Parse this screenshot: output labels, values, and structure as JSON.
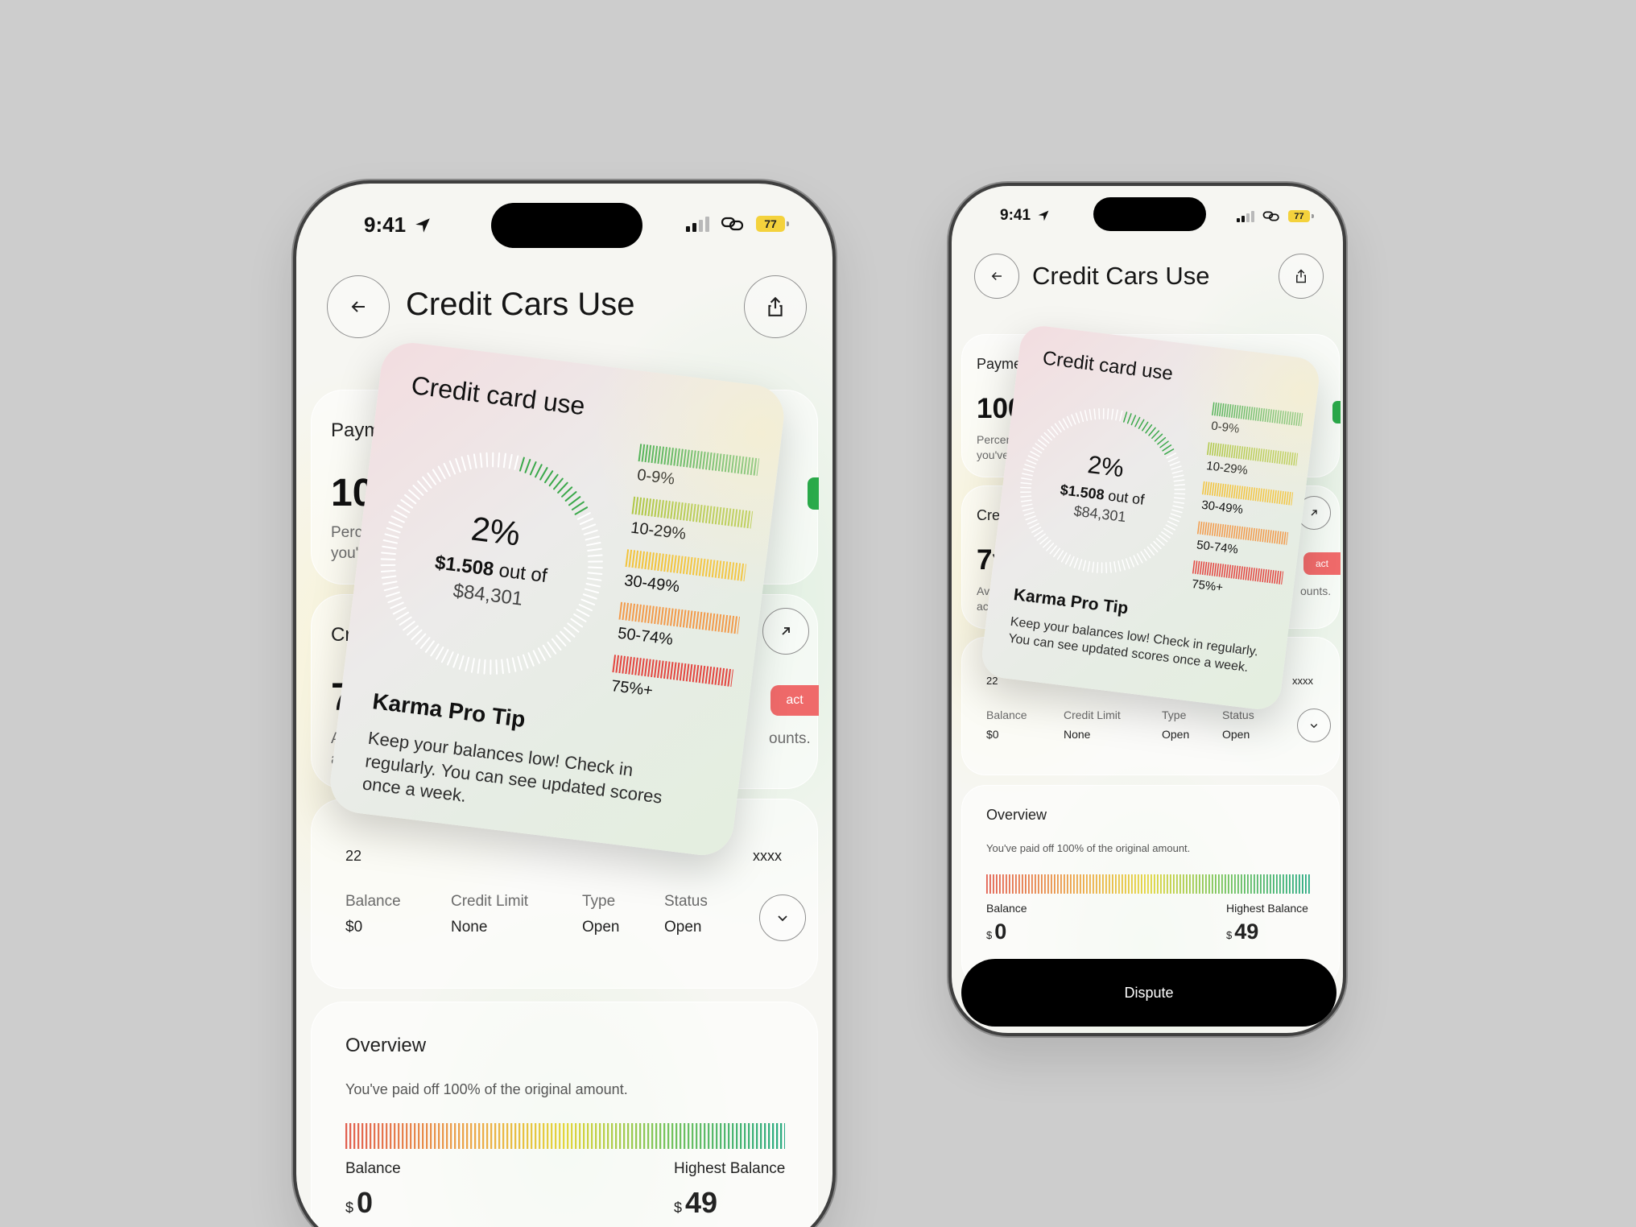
{
  "status": {
    "time": "9:41",
    "battery": "77"
  },
  "header": {
    "title": "Credit Cars Use"
  },
  "cards": {
    "payment": {
      "label": "Payment",
      "value": "100",
      "desc_line1": "Percenta",
      "desc_line2": "you've r"
    },
    "credit_age": {
      "label": "Cred",
      "value": "7y",
      "desc_line1": "Aver",
      "desc_line2": "acc",
      "badge": "act",
      "side_text": "ounts."
    },
    "account": {
      "number_left": "22",
      "number_right": "xxxx"
    },
    "details": {
      "columns": [
        {
          "label": "Balance",
          "value": "$0"
        },
        {
          "label": "Credit Limit",
          "value": "None"
        },
        {
          "label": "Type",
          "value": "Open"
        },
        {
          "label": "Status",
          "value": "Open"
        }
      ]
    }
  },
  "overview": {
    "title": "Overview",
    "subtitle": "You've paid off 100% of the original amount.",
    "balance_label": "Balance",
    "balance_value": "0",
    "highest_label": "Highest Balance",
    "highest_value": "49",
    "currency": "$",
    "progress_fraction": 1.0
  },
  "floating_card": {
    "title": "Credit card use",
    "percent": "2%",
    "amount": "$1.508",
    "out_of": "out of",
    "total": "$84,301",
    "usage_fraction": 0.12,
    "ranges": [
      {
        "label": "0-9%",
        "color": "#36a844"
      },
      {
        "label": "10-29%",
        "color": "#a9c43a"
      },
      {
        "label": "30-49%",
        "color": "#f2c33a"
      },
      {
        "label": "50-74%",
        "color": "#f29a4a"
      },
      {
        "label": "75%+",
        "color": "#e3453f"
      }
    ],
    "tip_title": "Karma Pro Tip",
    "tip_text": "Keep your balances low! Check in regularly. You can see updated scores once a week."
  },
  "dispute_button": "Dispute",
  "colors": {
    "accent_red": "#ef6a6a",
    "accent_green": "#2aaa4a",
    "button_dark": "#000000"
  }
}
